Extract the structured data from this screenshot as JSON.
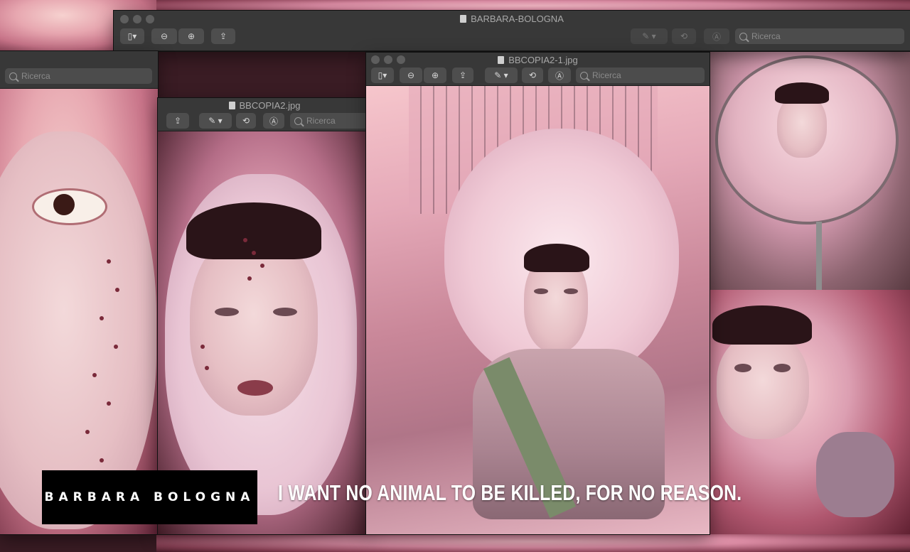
{
  "brand": {
    "name": "BARBARA BOLOGNA"
  },
  "slogan": "I WANT NO ANIMAL TO BE KILLED, FOR NO REASON.",
  "windows": {
    "back": {
      "title": "BARBARA-BOLOGNA",
      "search_placeholder": "Ricerca"
    },
    "left": {
      "search_placeholder": "Ricerca"
    },
    "middle": {
      "title": "BBCOPIA2.jpg",
      "search_placeholder": "Ricerca"
    },
    "front": {
      "title": "BBCOPIA2-1.jpg",
      "search_placeholder": "Ricerca"
    }
  },
  "icons": {
    "sidebar": "sidebar-toggle-icon",
    "zoom_out": "zoom-out-icon",
    "zoom_in": "zoom-in-icon",
    "share": "share-icon",
    "markup": "markup-pen-icon",
    "rotate": "rotate-icon",
    "annotate": "annotate-icon",
    "search": "search-icon"
  },
  "colors": {
    "toolbar": "#383838",
    "overlay_box": "#000000",
    "overlay_text": "#ffffff"
  }
}
